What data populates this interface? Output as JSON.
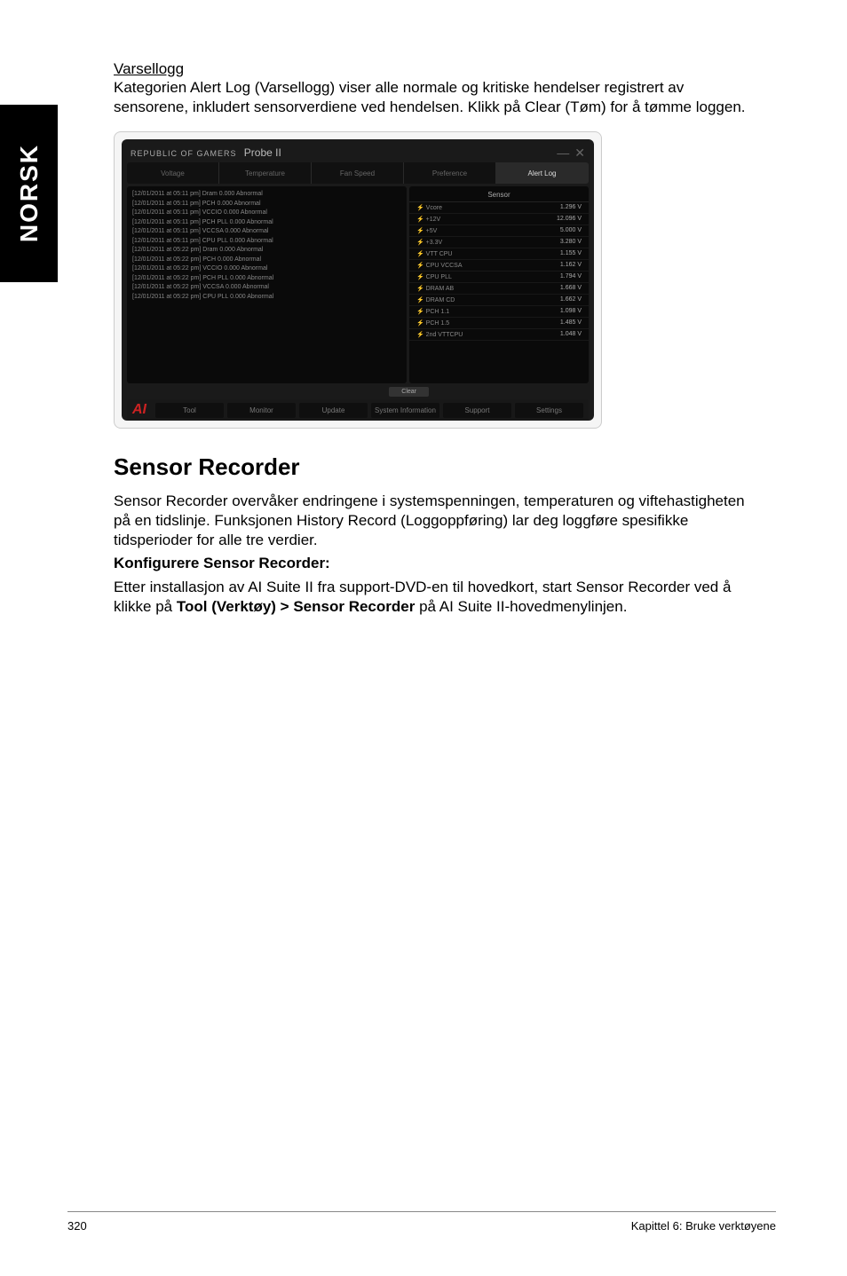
{
  "sidebar": {
    "language": "NORSK"
  },
  "varsellogg": {
    "title": "Varsellogg",
    "description": "Kategorien Alert Log (Varsellogg) viser alle normale og kritiske hendelser registrert av sensorene, inkludert sensorverdiene ved hendelsen. Klikk på Clear (Tøm) for å tømme loggen."
  },
  "app": {
    "brand": "REPUBLIC OF GAMERS",
    "title": "Probe II",
    "tabs": {
      "voltage": "Voltage",
      "temperature": "Temperature",
      "fan_speed": "Fan Speed",
      "preference": "Preference",
      "alert_log": "Alert Log"
    },
    "log_entries": [
      "[12/01/2011 at 05:11 pm] Dram 0.000 Abnormal",
      "[12/01/2011 at 05:11 pm] PCH 0.000 Abnormal",
      "[12/01/2011 at 05:11 pm] VCCIO 0.000 Abnormal",
      "[12/01/2011 at 05:11 pm] PCH PLL 0.000 Abnormal",
      "[12/01/2011 at 05:11 pm] VCCSA 0.000 Abnormal",
      "[12/01/2011 at 05:11 pm] CPU PLL 0.000 Abnormal",
      "[12/01/2011 at 05:22 pm] Dram 0.000 Abnormal",
      "[12/01/2011 at 05:22 pm] PCH 0.000 Abnormal",
      "[12/01/2011 at 05:22 pm] VCCIO 0.000 Abnormal",
      "[12/01/2011 at 05:22 pm] PCH PLL 0.000 Abnormal",
      "[12/01/2011 at 05:22 pm] VCCSA 0.000 Abnormal",
      "[12/01/2011 at 05:22 pm] CPU PLL 0.000 Abnormal"
    ],
    "sensor": {
      "header": "Sensor",
      "rows": [
        {
          "name": "Vcore",
          "value": "1.296 V"
        },
        {
          "name": "+12V",
          "value": "12.096 V"
        },
        {
          "name": "+5V",
          "value": "5.000 V"
        },
        {
          "name": "+3.3V",
          "value": "3.280 V"
        },
        {
          "name": "VTT CPU",
          "value": "1.155 V"
        },
        {
          "name": "CPU VCCSA",
          "value": "1.162 V"
        },
        {
          "name": "CPU PLL",
          "value": "1.794 V"
        },
        {
          "name": "DRAM AB",
          "value": "1.668 V"
        },
        {
          "name": "DRAM CD",
          "value": "1.662 V"
        },
        {
          "name": "PCH 1.1",
          "value": "1.098 V"
        },
        {
          "name": "PCH 1.5",
          "value": "1.485 V"
        },
        {
          "name": "2nd VTTCPU",
          "value": "1.048 V"
        }
      ]
    },
    "clear_button": "Clear",
    "bottom_bar": {
      "tool": "Tool",
      "monitor": "Monitor",
      "update": "Update",
      "system_info": "System Information",
      "support": "Support",
      "settings": "Settings"
    }
  },
  "sensor_recorder": {
    "heading": "Sensor Recorder",
    "p1": "Sensor Recorder overvåker endringene i systemspenningen, temperaturen og viftehastigheten på en tidslinje. Funksjonen History Record (Loggoppføring) lar deg loggføre spesifikke tidsperioder for alle tre verdier.",
    "configure_label": "Konfigurere Sensor Recorder:",
    "p2_pre": "Etter installasjon av AI Suite II fra support-DVD-en til hovedkort, start Sensor Recorder ved å klikke på ",
    "p2_bold": "Tool (Verktøy) > Sensor Recorder",
    "p2_post": " på AI Suite II-hovedmenylinjen."
  },
  "footer": {
    "page_number": "320",
    "chapter": "Kapittel 6: Bruke verktøyene"
  }
}
